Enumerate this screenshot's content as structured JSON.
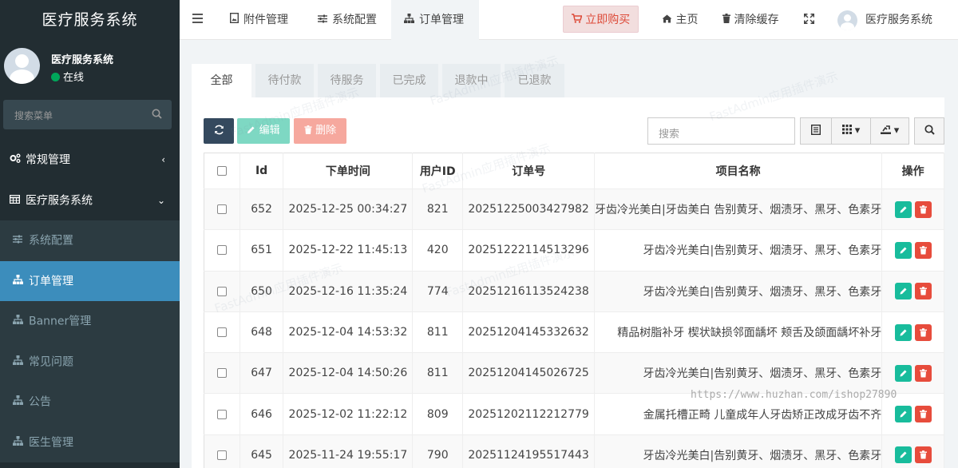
{
  "sidebar": {
    "brand": "医疗服务系统",
    "user_name": "医疗服务系统",
    "user_status": "在线",
    "search_placeholder": "搜索菜单",
    "items": [
      {
        "label": "常规管理",
        "icon": "cogs-icon",
        "kind": "top",
        "arrow": "‹"
      },
      {
        "label": "医疗服务系统",
        "icon": "table-icon",
        "kind": "top",
        "arrow": "⌄"
      },
      {
        "label": "系统配置",
        "icon": "sliders-icon",
        "kind": "sub"
      },
      {
        "label": "订单管理",
        "icon": "sitemap-icon",
        "kind": "active"
      },
      {
        "label": "Banner管理",
        "icon": "sitemap-icon",
        "kind": "sub"
      },
      {
        "label": "常见问题",
        "icon": "sitemap-icon",
        "kind": "sub"
      },
      {
        "label": "公告",
        "icon": "sitemap-icon",
        "kind": "sub"
      },
      {
        "label": "医生管理",
        "icon": "sitemap-icon",
        "kind": "sub"
      }
    ]
  },
  "header": {
    "tabs": [
      {
        "label": "附件管理",
        "icon": "file-image-icon"
      },
      {
        "label": "系统配置",
        "icon": "sliders-icon"
      },
      {
        "label": "订单管理",
        "icon": "sitemap-icon"
      }
    ],
    "buy_label": "立即购买",
    "home_label": "主页",
    "clear_cache_label": "清除缓存",
    "user_name": "医疗服务系统"
  },
  "filter_tabs": [
    "全部",
    "待付款",
    "待服务",
    "已完成",
    "退款中",
    "已退款"
  ],
  "toolbar": {
    "edit_label": "编辑",
    "delete_label": "删除",
    "search_placeholder": "搜索"
  },
  "table": {
    "columns": [
      "Id",
      "下单时间",
      "用户ID",
      "订单号",
      "项目名称",
      "操作"
    ],
    "rows": [
      {
        "id": "652",
        "time": "2025-12-25 00:34:27",
        "uid": "821",
        "order_no": "20251225003427982",
        "project": "牙齿冷光美白|牙齿美白 告别黄牙、烟渍牙、黑牙、色素牙"
      },
      {
        "id": "651",
        "time": "2025-12-22 11:45:13",
        "uid": "420",
        "order_no": "20251222114513296",
        "project": "牙齿冷光美白|告别黄牙、烟渍牙、黑牙、色素牙"
      },
      {
        "id": "650",
        "time": "2025-12-16 11:35:24",
        "uid": "774",
        "order_no": "20251216113524238",
        "project": "牙齿冷光美白|告别黄牙、烟渍牙、黑牙、色素牙"
      },
      {
        "id": "648",
        "time": "2025-12-04 14:53:32",
        "uid": "811",
        "order_no": "20251204145332632",
        "project": "精品树脂补牙 楔状缺损邻面龋坏 颊舌及颌面龋坏补牙"
      },
      {
        "id": "647",
        "time": "2025-12-04 14:50:26",
        "uid": "811",
        "order_no": "20251204145026725",
        "project": "牙齿冷光美白|告别黄牙、烟渍牙、黑牙、色素牙"
      },
      {
        "id": "646",
        "time": "2025-12-02 11:22:12",
        "uid": "809",
        "order_no": "20251202112212779",
        "project": "金属托槽正畸 儿童成年人牙齿矫正改成牙齿不齐"
      },
      {
        "id": "645",
        "time": "2025-11-24 19:55:17",
        "uid": "790",
        "order_no": "20251124195517443",
        "project": "牙齿冷光美白|告别黄牙、烟渍牙、黑牙、色素牙"
      }
    ]
  },
  "watermark_text": "FastAdmin应用插件演示",
  "url_watermark": "https://www.huzhan.com/ishop27890",
  "colors": {
    "sidebar_bg": "#222d32",
    "active_menu": "#3c8dbc",
    "refresh_btn": "#34495e",
    "edit_btn": "#7ed8c3",
    "delete_btn": "#f6a89e",
    "op_edit": "#18bc9c",
    "op_delete": "#e74c3c",
    "buy_btn_text": "#dd4b39"
  }
}
